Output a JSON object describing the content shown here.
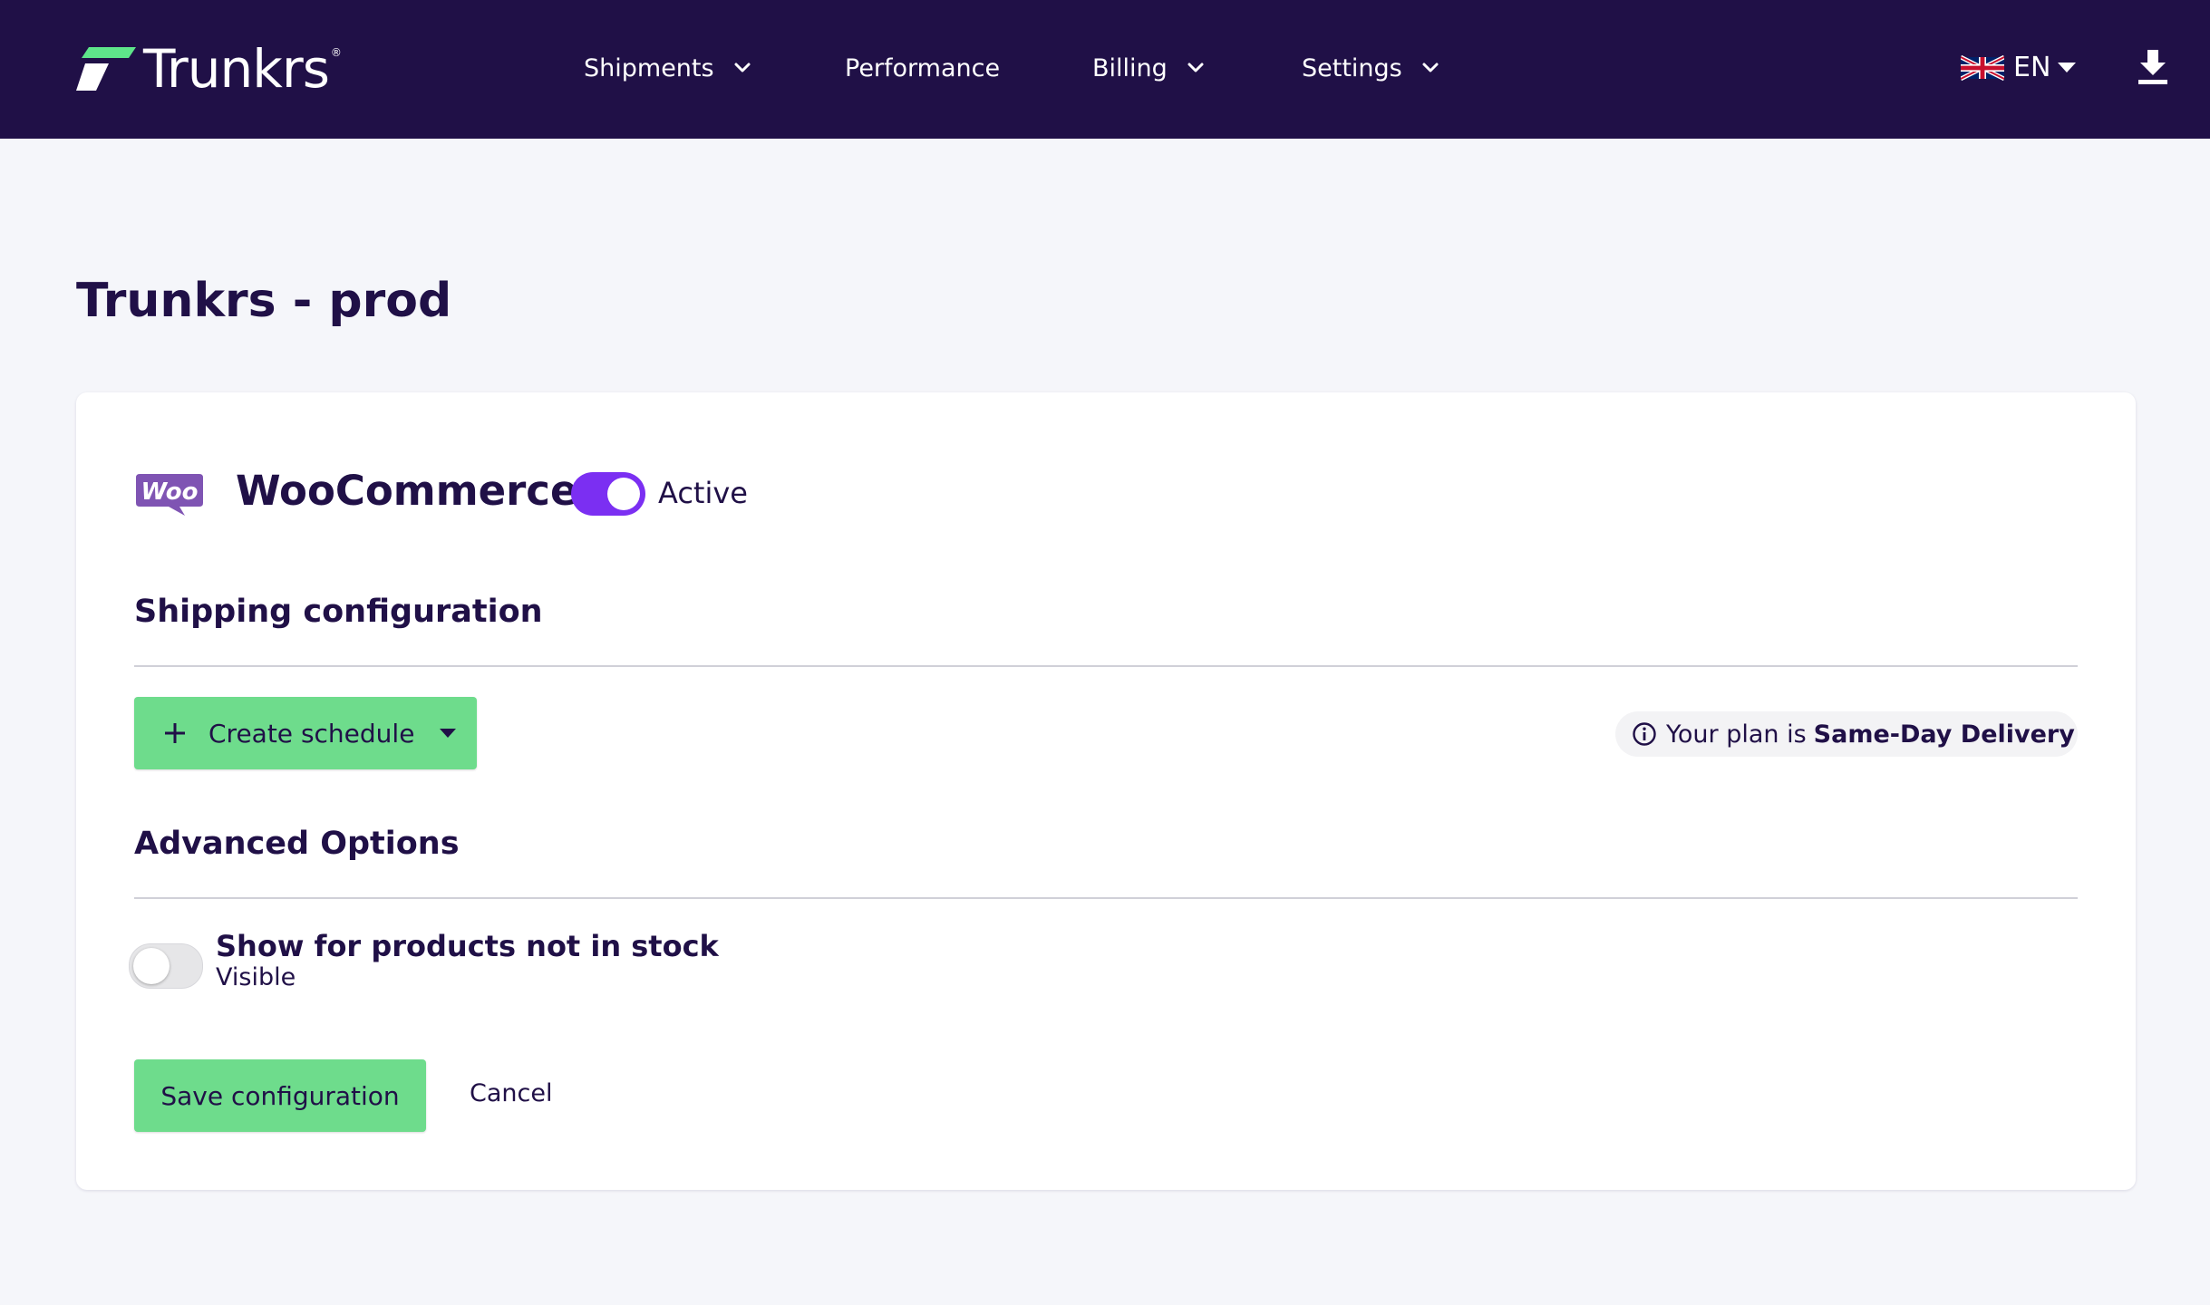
{
  "brand": {
    "name": "Trunkrs",
    "reg_mark": "®"
  },
  "nav": {
    "items": [
      {
        "label": "Shipments",
        "has_dropdown": true
      },
      {
        "label": "Performance",
        "has_dropdown": false
      },
      {
        "label": "Billing",
        "has_dropdown": true
      },
      {
        "label": "Settings",
        "has_dropdown": true
      }
    ],
    "language": {
      "code": "EN",
      "flag": "uk-flag-icon"
    },
    "download_icon": "download-icon"
  },
  "page": {
    "title": "Trunkrs - prod"
  },
  "integration": {
    "logo_text": "Woo",
    "name": "WooCommerce",
    "active": true,
    "status_label": "Active"
  },
  "shipping": {
    "section_title": "Shipping configuration",
    "create_button_label": "Create schedule",
    "plan_prefix": "Your plan is",
    "plan_name": "Same-Day Delivery"
  },
  "advanced": {
    "section_title": "Advanced Options",
    "option_label": "Show for products not in stock",
    "option_value": "Visible",
    "option_enabled": false
  },
  "actions": {
    "save_label": "Save configuration",
    "cancel_label": "Cancel"
  },
  "colors": {
    "nav_bg": "#201047",
    "accent_purple": "#7b2ff2",
    "button_green": "#6edc8c",
    "page_bg": "#f5f6fa",
    "brand_green": "#5ee58a"
  }
}
